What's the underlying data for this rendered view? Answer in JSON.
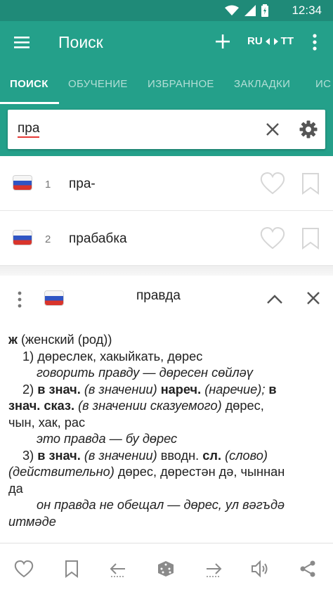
{
  "status_bar": {
    "time": "12:34"
  },
  "app_bar": {
    "title": "Поиск",
    "lang_from": "RU",
    "lang_to": "TT"
  },
  "tabs": [
    {
      "label": "ПОИСК"
    },
    {
      "label": "ОБУЧЕНИЕ"
    },
    {
      "label": "ИЗБРАННОЕ"
    },
    {
      "label": "ЗАКЛАДКИ"
    },
    {
      "label": "ИС"
    }
  ],
  "search": {
    "value": "пра"
  },
  "results": [
    {
      "num": "1",
      "word": "пра-"
    },
    {
      "num": "2",
      "word": "прабабка"
    }
  ],
  "entry": {
    "headword": "правда",
    "lines": [
      [
        {
          "t": "ж",
          "s": "b"
        },
        {
          "t": " (женский (род))",
          "s": ""
        }
      ],
      [
        {
          "t": "1) дөреслек, хакыйкать, дөрес",
          "s": ""
        }
      ],
      [
        {
          "t": "говорить правду — дөресен сөйләү",
          "s": "i"
        }
      ],
      [
        {
          "t": "2) ",
          "s": ""
        },
        {
          "t": "в знач.",
          "s": "b"
        },
        {
          "t": " (в значении) ",
          "s": "i"
        },
        {
          "t": "нареч.",
          "s": "b"
        },
        {
          "t": " (наречие); ",
          "s": "i"
        },
        {
          "t": "в",
          "s": "b"
        }
      ],
      [
        {
          "t": "знач. сказ.",
          "s": "b"
        },
        {
          "t": " (в значении сказуемого) ",
          "s": "i"
        },
        {
          "t": "дөрес,",
          "s": ""
        }
      ],
      [
        {
          "t": "чын, хак, рас",
          "s": ""
        }
      ],
      [
        {
          "t": "это правда — бу дөрес",
          "s": "i"
        }
      ],
      [
        {
          "t": "3) ",
          "s": ""
        },
        {
          "t": "в знач.",
          "s": "b"
        },
        {
          "t": " (в значении) ",
          "s": "i"
        },
        {
          "t": "вводн. ",
          "s": ""
        },
        {
          "t": "сл.",
          "s": "b"
        },
        {
          "t": " (слово)",
          "s": "i"
        }
      ],
      [
        {
          "t": "(действительно)",
          "s": "i"
        },
        {
          "t": " дөрес, дөрестән дә, чыннан",
          "s": ""
        }
      ],
      [
        {
          "t": "да",
          "s": ""
        }
      ],
      [
        {
          "t": "он правда не обещал — дөрес, ул вәгъдә",
          "s": "i"
        }
      ],
      [
        {
          "t": "итмәде",
          "s": "i"
        }
      ]
    ],
    "indents": [
      0,
      1,
      2,
      1,
      0,
      0,
      2,
      1,
      0,
      0,
      2,
      0
    ]
  },
  "colors": {
    "primary": "#24a08a",
    "primary_dark": "#1f8a78",
    "accent_underline": "#e53935",
    "icon_gray": "#8a8a8a"
  },
  "icons": {
    "bottom_bar": [
      "heart-icon",
      "bookmark-icon",
      "back-arrow-icon",
      "dice-icon",
      "forward-arrow-icon",
      "speaker-icon",
      "share-icon"
    ]
  }
}
